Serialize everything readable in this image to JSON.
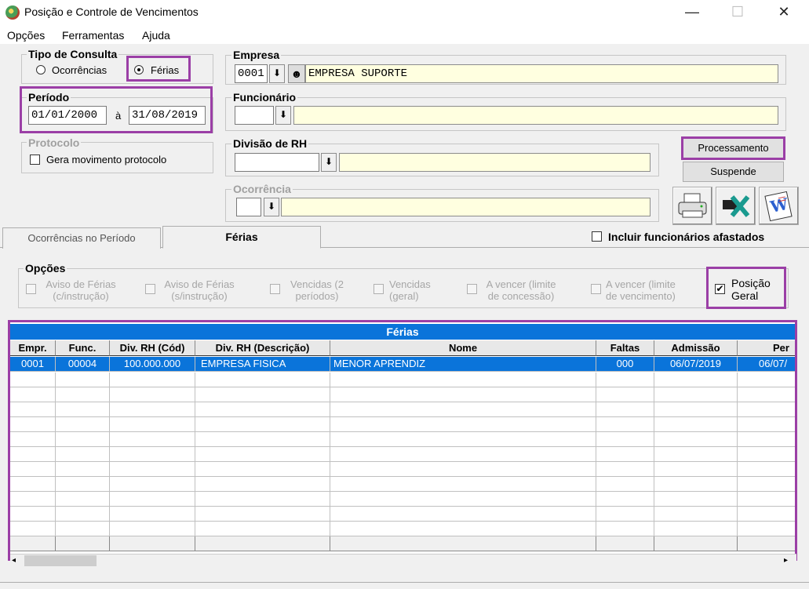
{
  "window": {
    "title": "Posição e Controle de Vencimentos",
    "min": "—",
    "max": "☐",
    "close": "✕"
  },
  "menu": [
    "Opções",
    "Ferramentas",
    "Ajuda"
  ],
  "tipo_consulta": {
    "legend": "Tipo de Consulta",
    "opt1": "Ocorrências",
    "opt2": "Férias",
    "selected": "Férias"
  },
  "periodo": {
    "legend": "Período",
    "from": "01/01/2000",
    "sep": "à",
    "to": "31/08/2019"
  },
  "protocolo": {
    "legend": "Protocolo",
    "check": "Gera movimento protocolo"
  },
  "empresa": {
    "legend": "Empresa",
    "code": "0001",
    "name": "EMPRESA SUPORTE"
  },
  "funcionario": {
    "legend": "Funcionário",
    "code": "",
    "name": ""
  },
  "divisao": {
    "legend": "Divisão de RH",
    "code": "",
    "name": ""
  },
  "ocorrencia": {
    "legend": "Ocorrência",
    "code": "",
    "name": ""
  },
  "buttons": {
    "processamento": "Processamento",
    "suspende": "Suspende"
  },
  "tabs": {
    "t1": "Ocorrências no Período",
    "t2": "Férias"
  },
  "incluir": "Incluir funcionários afastados",
  "opcoes": {
    "legend": "Opções",
    "o1": "Aviso de Férias (c/instrução)",
    "o2": "Aviso de Férias (s/instrução)",
    "o3": "Vencidas (2 períodos)",
    "o4": "Vencidas (geral)",
    "o5": "A vencer (limite de concessão)",
    "o6": "A vencer (limite de vencimento)",
    "o7": "Posição Geral"
  },
  "grid": {
    "title": "Férias",
    "headers": [
      "Empr.",
      "Func.",
      "Div. RH (Cód)",
      "Div. RH (Descrição)",
      "Nome",
      "Faltas",
      "Admissão",
      "Per"
    ],
    "row": [
      "0001",
      "00004",
      "100.000.000",
      "EMPRESA FISICA",
      "MENOR APRENDIZ",
      "000",
      "06/07/2019",
      "06/07/"
    ]
  },
  "colors": {
    "accent": "#0a74da",
    "highlight": "#9b3fa6",
    "field_yellow": "#ffffe0"
  }
}
